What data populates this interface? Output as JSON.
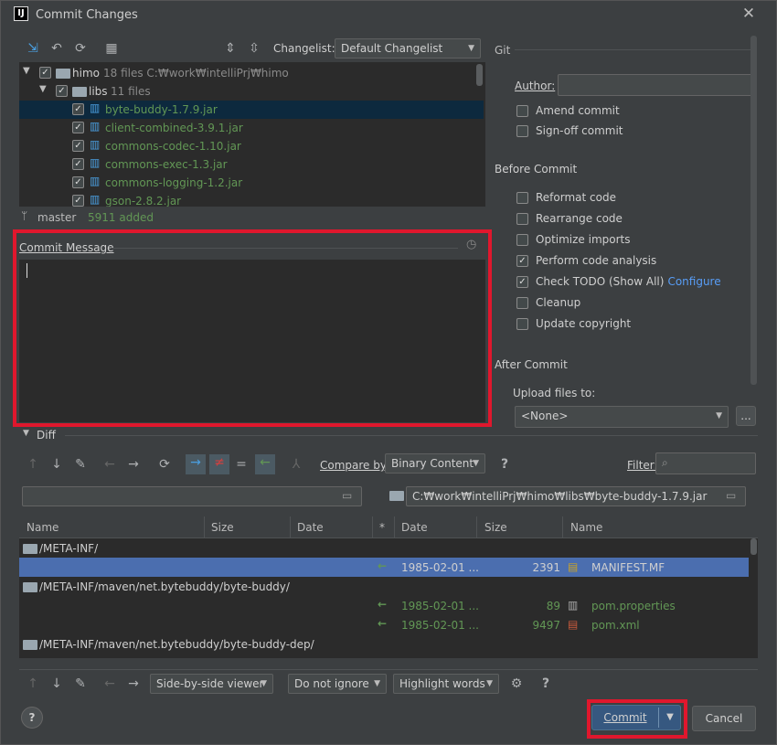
{
  "window": {
    "title": "Commit Changes"
  },
  "toolbar": {
    "changelist_label": "Changelist:",
    "changelist_value": "Default Changelist"
  },
  "tree": {
    "root": {
      "name": "himo",
      "meta": "18 files  C:₩work₩intelliPrj₩himo"
    },
    "libs": {
      "name": "libs",
      "meta": "11 files"
    },
    "files": [
      "byte-buddy-1.7.9.jar",
      "client-combined-3.9.1.jar",
      "commons-codec-1.10.jar",
      "commons-exec-1.3.jar",
      "commons-logging-1.2.jar",
      "gson-2.8.2.jar"
    ]
  },
  "status": {
    "branch": "master",
    "added": "5911 added"
  },
  "commit_message": {
    "label": "Commit Message",
    "value": ""
  },
  "git": {
    "section": "Git",
    "author_label": "Author:",
    "author_value": "",
    "amend": "Amend commit",
    "signoff": "Sign-off commit",
    "before_title": "Before Commit",
    "before": [
      {
        "label": "Reformat code",
        "checked": false
      },
      {
        "label": "Rearrange code",
        "checked": false
      },
      {
        "label": "Optimize imports",
        "checked": false
      },
      {
        "label": "Perform code analysis",
        "checked": true
      },
      {
        "label": "Check TODO (Show All)",
        "checked": true
      },
      {
        "label": "Cleanup",
        "checked": false
      },
      {
        "label": "Update copyright",
        "checked": false
      }
    ],
    "configure": "Configure",
    "after_title": "After Commit",
    "upload_label": "Upload files to:",
    "upload_value": "<None>",
    "upload_more": "..."
  },
  "diff": {
    "title": "Diff",
    "compare_label": "Compare by:",
    "compare_value": "Binary Content",
    "filter_label": "Filter:",
    "left_path": "",
    "right_path": "C:₩work₩intelliPrj₩himo₩libs₩byte-buddy-1.7.9.jar",
    "columns": {
      "name": "Name",
      "size": "Size",
      "date": "Date",
      "star": "*",
      "date2": "Date",
      "size2": "Size",
      "name2": "Name"
    },
    "rows": [
      {
        "folder": "/META-INF/"
      },
      {
        "date": "1985-02-01 ...",
        "size": "2391",
        "name": "MANIFEST.MF",
        "selected": true
      },
      {
        "folder": "/META-INF/maven/net.bytebuddy/byte-buddy/"
      },
      {
        "date": "1985-02-01 ...",
        "size": "89",
        "name": "pom.properties"
      },
      {
        "date": "1985-02-01 ...",
        "size": "9497",
        "name": "pom.xml"
      },
      {
        "folder": "/META-INF/maven/net.bytebuddy/byte-buddy-dep/"
      }
    ],
    "viewer": "Side-by-side viewer",
    "ignore": "Do not ignore",
    "highlight": "Highlight words"
  },
  "buttons": {
    "help": "?",
    "commit": "Commit",
    "cancel": "Cancel"
  }
}
